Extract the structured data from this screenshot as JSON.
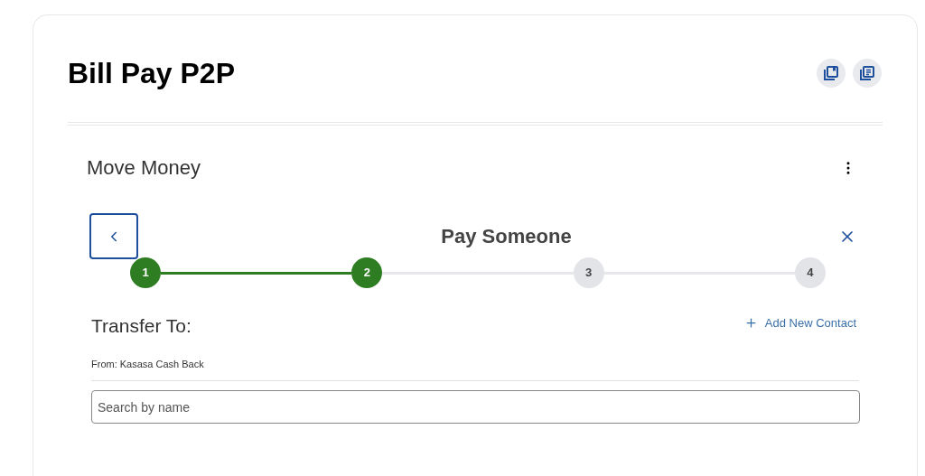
{
  "page": {
    "title": "Bill Pay P2P"
  },
  "section": {
    "title": "Move Money"
  },
  "wizard": {
    "title": "Pay Someone",
    "steps": [
      {
        "label": "1",
        "done": true
      },
      {
        "label": "2",
        "done": true
      },
      {
        "label": "3",
        "done": false
      },
      {
        "label": "4",
        "done": false
      }
    ]
  },
  "transfer": {
    "heading": "Transfer To:",
    "add_link": "Add New Contact",
    "from": "From: Kasasa Cash Back",
    "search": {
      "placeholder": "Search by name"
    }
  }
}
